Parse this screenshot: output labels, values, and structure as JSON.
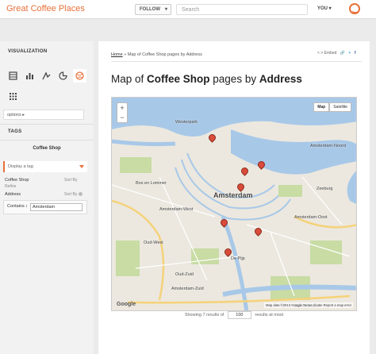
{
  "topbar": {
    "brand": "Great Coffee Places",
    "follow_label": "FOLLOW",
    "search_placeholder": "Search",
    "you_label": "YOU"
  },
  "sidebar": {
    "visualization_heading": "VISUALIZATION",
    "vis_icons": [
      "table-icon",
      "bar-chart-icon",
      "line-chart-icon",
      "pie-chart-icon",
      "map-icon",
      "grid-icon"
    ],
    "options_label": "options ▸",
    "tags_heading": "TAGS",
    "tag_title": "Coffee Shop",
    "display_tag": "Display a tag",
    "coffee_shop_label": "Coffee Shop",
    "refine_label": "Refine",
    "sort_by_1": "Sort By",
    "address_label": "Address",
    "sort_by_2": "Sort By",
    "contains_select": "Contains ↕",
    "contains_value": "Amsterdam"
  },
  "panel": {
    "breadcrumb_home": "Home",
    "breadcrumb_sep": "»",
    "breadcrumb_page": "Map of Coffee Shop pages by Address",
    "embed_label": "< > Embed",
    "title_pre": "Map of ",
    "title_bold1": "Coffee Shop",
    "title_mid": " pages by ",
    "title_bold2": "Address",
    "results_pre": "Showing 7 results of",
    "results_count": "100",
    "results_post": "results at most"
  },
  "map": {
    "labels": [
      "Westerpark",
      "Amsterdam-Noord",
      "Amsterdam",
      "Amsterdam-West",
      "Bos en Lommer",
      "Amsterdam-Oost",
      "Zeeburg",
      "Oud-West",
      "De Pijp",
      "Oud-Zuid",
      "Amsterdam-Zuid",
      "Buitenveldert"
    ],
    "zoom_in": "+",
    "zoom_out": "−",
    "map_types": [
      "Map",
      "Satellite"
    ],
    "google": "Google",
    "footer": "Map data ©2013 Google  Terms of Use  Report a map error",
    "pins": 7
  },
  "colors": {
    "accent": "#e8703a",
    "water": "#a8c8e8",
    "land": "#ece8df",
    "park": "#c8dca4",
    "pin": "#d94b3a"
  }
}
